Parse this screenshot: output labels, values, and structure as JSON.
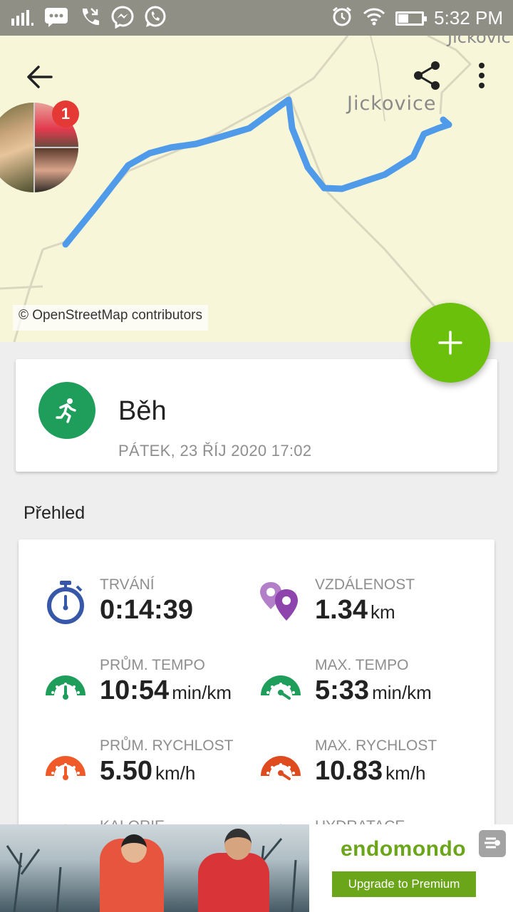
{
  "status_bar": {
    "time": "5:32 PM",
    "icons": [
      "signal-icon",
      "message-icon",
      "call-forward-icon",
      "messenger-icon",
      "whatsapp-icon",
      "alarm-icon",
      "wifi-icon",
      "battery-icon"
    ]
  },
  "map": {
    "town_label": "Jickovice",
    "town_label_top": "Jickovic",
    "credit": "© OpenStreetMap contributors",
    "route_color": "#4f9bea",
    "avatar_badge": "1"
  },
  "activity": {
    "name": "Běh",
    "date": "PÁTEK, 23 ŘÍJ 2020 17:02",
    "icon_color": "#1e9d5b"
  },
  "overview": {
    "title": "Přehled",
    "stats": [
      {
        "label": "TRVÁNÍ",
        "value": "0:14:39",
        "unit": "",
        "icon": "stopwatch-icon",
        "color": "#3757a8"
      },
      {
        "label": "VZDÁLENOST",
        "value": "1.34",
        "unit": "km",
        "icon": "location-pins-icon",
        "color": "#8e44ad"
      },
      {
        "label": "PRŮM. TEMPO",
        "value": "10:54",
        "unit": "min/km",
        "icon": "speedometer-avg-icon",
        "color": "#1e9d5b"
      },
      {
        "label": "MAX. TEMPO",
        "value": "5:33",
        "unit": "min/km",
        "icon": "speedometer-max-icon",
        "color": "#1e9d5b"
      },
      {
        "label": "PRŮM. RYCHLOST",
        "value": "5.50",
        "unit": "km/h",
        "icon": "speedometer-avg-speed-icon",
        "color": "#f05a28"
      },
      {
        "label": "MAX. RYCHLOST",
        "value": "10.83",
        "unit": "km/h",
        "icon": "speedometer-max-speed-icon",
        "color": "#e04a1f"
      },
      {
        "label": "KALORIE",
        "value": "",
        "unit": "",
        "icon": "flame-icon",
        "color": "#f5a623"
      },
      {
        "label": "HYDRATACE",
        "value": "",
        "unit": "",
        "icon": "drop-icon",
        "color": "#4aa3df"
      }
    ]
  },
  "ad": {
    "brand": "endomondo",
    "cta": "Upgrade to Premium",
    "brand_color": "#6aa51a"
  }
}
